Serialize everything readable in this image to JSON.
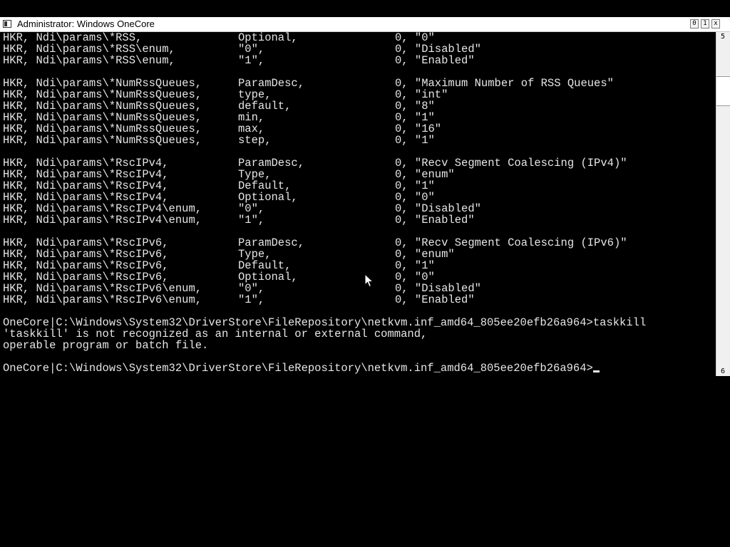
{
  "window": {
    "title": "Administrator:  Windows OneCore",
    "buttons": {
      "minimize": "0",
      "maximize": "1",
      "close": "x"
    }
  },
  "scrollbar": {
    "top_label": "5",
    "bottom_label": "6"
  },
  "console": {
    "rows": [
      [
        "HKR, Ndi\\params\\*RSS,",
        "Optional,",
        "0, \"0\""
      ],
      [
        "HKR, Ndi\\params\\*RSS\\enum,",
        "\"0\",",
        "0, \"Disabled\""
      ],
      [
        "HKR, Ndi\\params\\*RSS\\enum,",
        "\"1\",",
        "0, \"Enabled\""
      ],
      [
        "",
        "",
        ""
      ],
      [
        "HKR, Ndi\\params\\*NumRssQueues,",
        "ParamDesc,",
        "0, \"Maximum Number of RSS Queues\""
      ],
      [
        "HKR, Ndi\\params\\*NumRssQueues,",
        "type,",
        "0, \"int\""
      ],
      [
        "HKR, Ndi\\params\\*NumRssQueues,",
        "default,",
        "0, \"8\""
      ],
      [
        "HKR, Ndi\\params\\*NumRssQueues,",
        "min,",
        "0, \"1\""
      ],
      [
        "HKR, Ndi\\params\\*NumRssQueues,",
        "max,",
        "0, \"16\""
      ],
      [
        "HKR, Ndi\\params\\*NumRssQueues,",
        "step,",
        "0, \"1\""
      ],
      [
        "",
        "",
        ""
      ],
      [
        "HKR, Ndi\\params\\*RscIPv4,",
        "ParamDesc,",
        "0, \"Recv Segment Coalescing (IPv4)\""
      ],
      [
        "HKR, Ndi\\params\\*RscIPv4,",
        "Type,",
        "0, \"enum\""
      ],
      [
        "HKR, Ndi\\params\\*RscIPv4,",
        "Default,",
        "0, \"1\""
      ],
      [
        "HKR, Ndi\\params\\*RscIPv4,",
        "Optional,",
        "0, \"0\""
      ],
      [
        "HKR, Ndi\\params\\*RscIPv4\\enum,",
        "\"0\",",
        "0, \"Disabled\""
      ],
      [
        "HKR, Ndi\\params\\*RscIPv4\\enum,",
        "\"1\",",
        "0, \"Enabled\""
      ],
      [
        "",
        "",
        ""
      ],
      [
        "HKR, Ndi\\params\\*RscIPv6,",
        "ParamDesc,",
        "0, \"Recv Segment Coalescing (IPv6)\""
      ],
      [
        "HKR, Ndi\\params\\*RscIPv6,",
        "Type,",
        "0, \"enum\""
      ],
      [
        "HKR, Ndi\\params\\*RscIPv6,",
        "Default,",
        "0, \"1\""
      ],
      [
        "HKR, Ndi\\params\\*RscIPv6,",
        "Optional,",
        "0, \"0\""
      ],
      [
        "HKR, Ndi\\params\\*RscIPv6\\enum,",
        "\"0\",",
        "0, \"Disabled\""
      ],
      [
        "HKR, Ndi\\params\\*RscIPv6\\enum,",
        "\"1\",",
        "0, \"Enabled\""
      ],
      [
        "",
        "",
        ""
      ]
    ],
    "lines": [
      "OneCore|C:\\Windows\\System32\\DriverStore\\FileRepository\\netkvm.inf_amd64_805ee20efb26a964>taskkill",
      "'taskkill' is not recognized as an internal or external command,",
      "operable program or batch file.",
      ""
    ],
    "prompt": "OneCore|C:\\Windows\\System32\\DriverStore\\FileRepository\\netkvm.inf_amd64_805ee20efb26a964>"
  }
}
